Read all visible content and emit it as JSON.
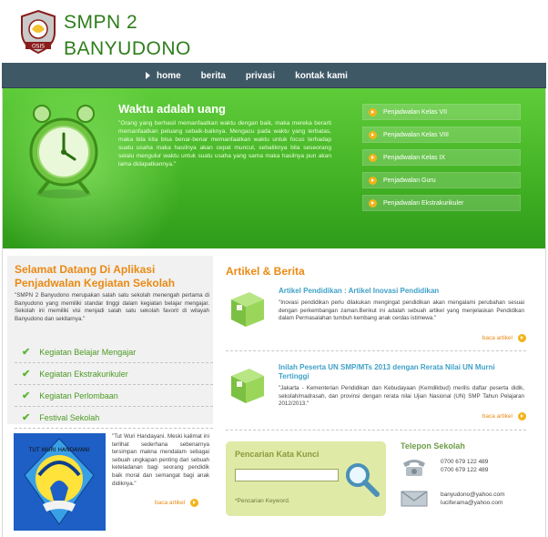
{
  "header": {
    "title_line1": "SMPN 2",
    "title_line2": "BANYUDONO",
    "logo_text": "OSIS"
  },
  "nav": {
    "items": [
      "home",
      "berita",
      "privasi",
      "kontak kami"
    ],
    "active": "home"
  },
  "hero": {
    "title": "Waktu adalah uang",
    "text": "\"Orang yang berhasil memanfaatkan waktu dengan baik, maka mereka berarti memanfaatkan peluang sebaik-baiknya. Mengacu pada waktu yang terbatas, maka bila kita bisa benar-benar memanfaatkan waktu untuk focus terhadap suatu usaha maka hasilnya akan cepat muncul, sebaliknya bila seseorang selalu mengulur waktu untuk suatu usaha yang sama maka hasilnya pun akan lama didapatkannya.\"",
    "menu": [
      "Penjadwalan Kelas VII",
      "Penjadwalan Kelas VIII",
      "Penjadwalan Kelas IX",
      "Penjadwalan Guru",
      "Penjadwalan Ekstrakurikuler"
    ]
  },
  "welcome": {
    "title": "Selamat Datang Di Aplikasi Penjadwalan Kegiatan Sekolah",
    "text": "\"SMPN 2 Banyudono merupakan salah satu sekolah menengah pertama di Banyudono yang memiliki standar tinggi dalam kegiatan belajar mengajar. Sekolah ini memiliki visi menjadi salah satu sekolah favorit di wilayah Banyudono dan sekitarnya.\"",
    "activities": [
      "Kegiatan Belajar Mengajar",
      "Kegiatan Ekstrakurikuler",
      "Kegiatan Perlombaan",
      "Festival Sekolah"
    ]
  },
  "tutwuri": {
    "logo_text": "TUT WURI HANDAYANI",
    "text": "\"Tut Wuri Handayani. Meski kalimat ini terlihat sederhana sebenarnya tersimpan makna mendalam sebagai sebuah ungkapan penting dari sebuah keteladanan bagi seorang pendidik baik moral dan semangat bagi anak didiknya.\"",
    "more": "baca artikel"
  },
  "articles": {
    "title": "Artikel & Berita",
    "items": [
      {
        "title": "Artikel Pendidikan : Artikel Inovasi Pendidikan",
        "text": "\"Inovasi pendidikan perlu dilakukan mengingat pendidikan akan mengalami perubahan sesuai dengan perkembangan zaman.Berikut ini adalah sebuah artikel yang menjelaskan Pendidikan dalam Permasalahan tumbuh kembang anak cerdas istimewa.\"",
        "more": "baca artikel"
      },
      {
        "title": "Inilah Peserta UN SMP/MTs 2013 dengan Rerata Nilai UN Murni Tertinggi",
        "text": "\"Jakarta - Kementerian Pendidikan dan Kebudayaan (Kemdikbud) merilis daftar peserta didik, sekolah/madrasah, dan provinsi dengan rerata nilai Ujian Nasional (UN) SMP Tahun Pelajaran 2012/2013.\"",
        "more": "baca artikel"
      }
    ]
  },
  "search": {
    "title": "Pencarian Kata Kunci",
    "value": "",
    "note": "*Pencarian Keyword."
  },
  "contact": {
    "title": "Telepon Sekolah",
    "phones": [
      "0700 679 122 489",
      "0700 679 122 489"
    ],
    "emails": [
      "banyudono@yahoo.com",
      "luciferama@yahoo.com"
    ]
  },
  "colors": {
    "brand_green": "#2e7d1c",
    "accent_orange": "#e98a14",
    "nav_bg": "#3f5866",
    "hero_green": "#44b325",
    "link_blue": "#3fa1c8"
  }
}
